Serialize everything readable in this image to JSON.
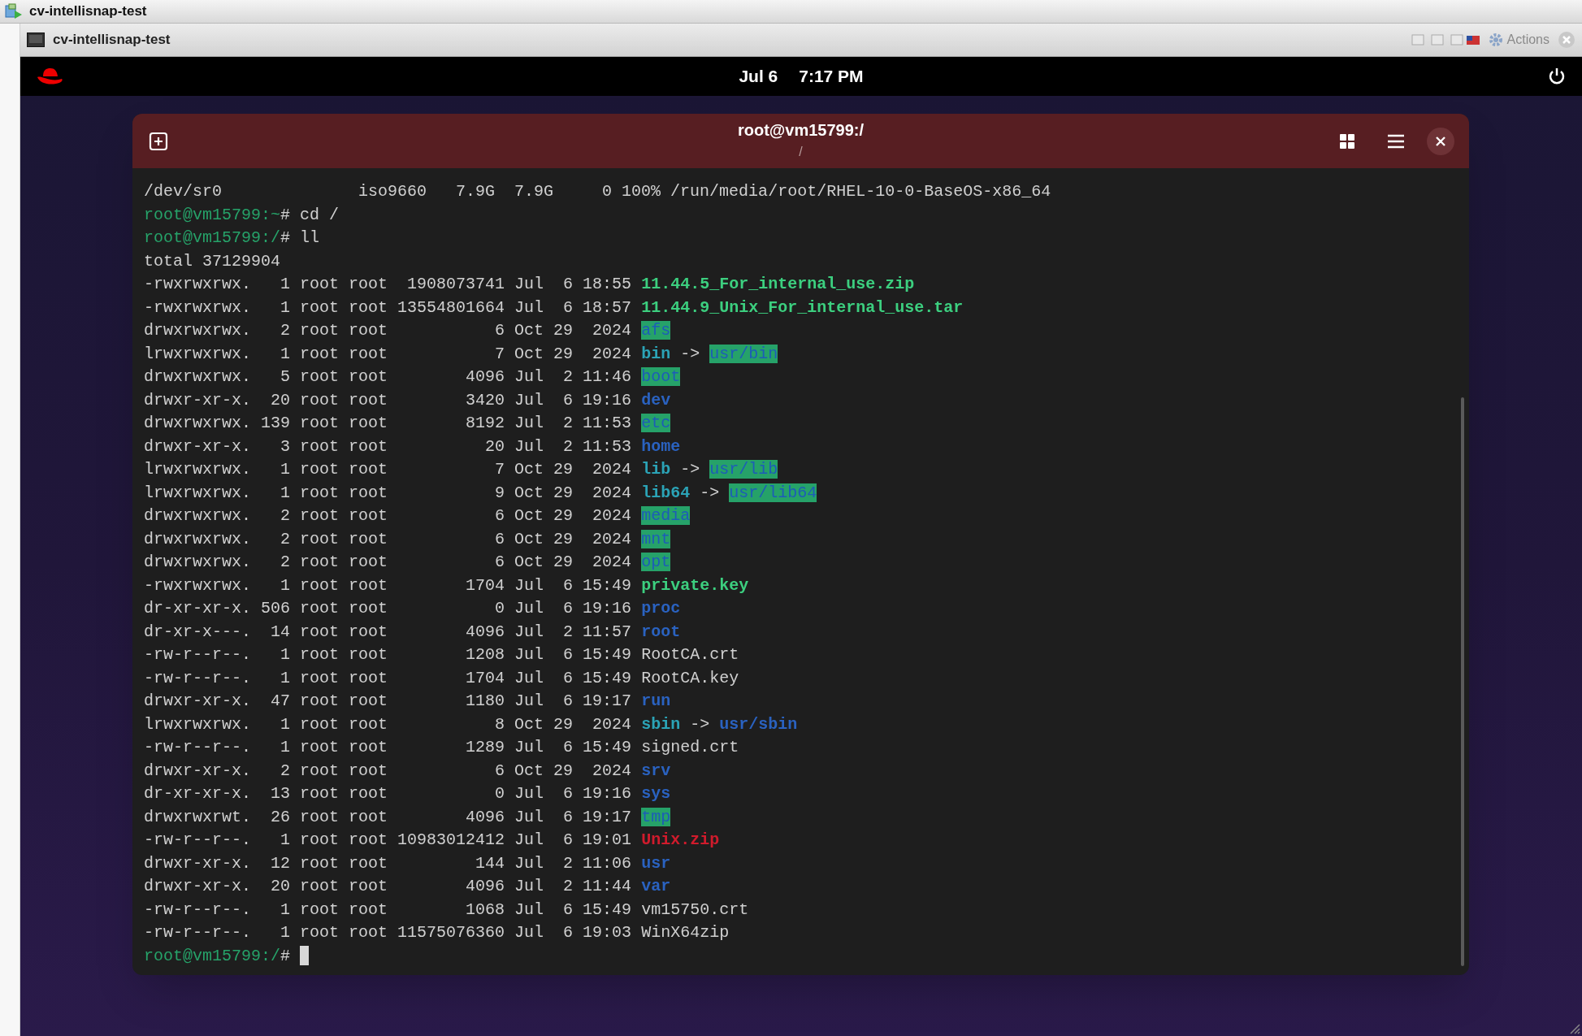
{
  "host_window": {
    "title": "cv-intellisnap-test"
  },
  "console_bar": {
    "title": "cv-intellisnap-test",
    "actions": "Actions"
  },
  "top_bar": {
    "date": "Jul 6",
    "time": "7:17 PM"
  },
  "terminal": {
    "title": "root@vm15799:/",
    "subtitle": "/",
    "lines": [
      {
        "kind": "output",
        "text": "/dev/sr0              iso9660   7.9G  7.9G     0 100% /run/media/root/RHEL-10-0-BaseOS-x86_64"
      },
      {
        "kind": "command",
        "prompt": "root@vm15799:~",
        "symbol": "#",
        "command": "cd /"
      },
      {
        "kind": "command",
        "prompt": "root@vm15799:/",
        "symbol": "#",
        "command": "ll"
      },
      {
        "kind": "output",
        "text": "total 37129904"
      },
      {
        "kind": "entry",
        "meta": "-rwxrwxrwx.   1 root root  1908073741 Jul  6 18:55",
        "name": {
          "text": "11.44.5_For_internal_use.zip",
          "kind": "exec"
        }
      },
      {
        "kind": "entry",
        "meta": "-rwxrwxrwx.   1 root root 13554801664 Jul  6 18:57",
        "name": {
          "text": "11.44.9_Unix_For_internal_use.tar",
          "kind": "exec"
        }
      },
      {
        "kind": "entry",
        "meta": "drwxrwxrwx.   2 root root           6 Oct 29  2024",
        "name": {
          "text": "afs",
          "kind": "dir_hl"
        }
      },
      {
        "kind": "entry",
        "meta": "lrwxrwxrwx.   1 root root           7 Oct 29  2024",
        "name": {
          "text": "bin",
          "kind": "link"
        },
        "arrow": "->",
        "target": {
          "text": "usr/bin",
          "kind": "dir_hl"
        }
      },
      {
        "kind": "entry",
        "meta": "drwxrwxrwx.   5 root root        4096 Jul  2 11:46",
        "name": {
          "text": "boot",
          "kind": "dir_hl"
        }
      },
      {
        "kind": "entry",
        "meta": "drwxr-xr-x.  20 root root        3420 Jul  6 19:16",
        "name": {
          "text": "dev",
          "kind": "dir"
        }
      },
      {
        "kind": "entry",
        "meta": "drwxrwxrwx. 139 root root        8192 Jul  2 11:53",
        "name": {
          "text": "etc",
          "kind": "dir_hl"
        }
      },
      {
        "kind": "entry",
        "meta": "drwxr-xr-x.   3 root root          20 Jul  2 11:53",
        "name": {
          "text": "home",
          "kind": "dir"
        }
      },
      {
        "kind": "entry",
        "meta": "lrwxrwxrwx.   1 root root           7 Oct 29  2024",
        "name": {
          "text": "lib",
          "kind": "link"
        },
        "arrow": "->",
        "target": {
          "text": "usr/lib",
          "kind": "dir_hl"
        }
      },
      {
        "kind": "entry",
        "meta": "lrwxrwxrwx.   1 root root           9 Oct 29  2024",
        "name": {
          "text": "lib64",
          "kind": "link"
        },
        "arrow": "->",
        "target": {
          "text": "usr/lib64",
          "kind": "dir_hl"
        }
      },
      {
        "kind": "entry",
        "meta": "drwxrwxrwx.   2 root root           6 Oct 29  2024",
        "name": {
          "text": "media",
          "kind": "dir_hl"
        }
      },
      {
        "kind": "entry",
        "meta": "drwxrwxrwx.   2 root root           6 Oct 29  2024",
        "name": {
          "text": "mnt",
          "kind": "dir_hl"
        }
      },
      {
        "kind": "entry",
        "meta": "drwxrwxrwx.   2 root root           6 Oct 29  2024",
        "name": {
          "text": "opt",
          "kind": "dir_hl"
        }
      },
      {
        "kind": "entry",
        "meta": "-rwxrwxrwx.   1 root root        1704 Jul  6 15:49",
        "name": {
          "text": "private.key",
          "kind": "exec"
        }
      },
      {
        "kind": "entry",
        "meta": "dr-xr-xr-x. 506 root root           0 Jul  6 19:16",
        "name": {
          "text": "proc",
          "kind": "dir"
        }
      },
      {
        "kind": "entry",
        "meta": "dr-xr-x---.  14 root root        4096 Jul  2 11:57",
        "name": {
          "text": "root",
          "kind": "dir"
        }
      },
      {
        "kind": "entry",
        "meta": "-rw-r--r--.   1 root root        1208 Jul  6 15:49",
        "name": {
          "text": "RootCA.crt",
          "kind": "file"
        }
      },
      {
        "kind": "entry",
        "meta": "-rw-r--r--.   1 root root        1704 Jul  6 15:49",
        "name": {
          "text": "RootCA.key",
          "kind": "file"
        }
      },
      {
        "kind": "entry",
        "meta": "drwxr-xr-x.  47 root root        1180 Jul  6 19:17",
        "name": {
          "text": "run",
          "kind": "dir"
        }
      },
      {
        "kind": "entry",
        "meta": "lrwxrwxrwx.   1 root root           8 Oct 29  2024",
        "name": {
          "text": "sbin",
          "kind": "link"
        },
        "arrow": "->",
        "target": {
          "text": "usr/sbin",
          "kind": "dir"
        }
      },
      {
        "kind": "entry",
        "meta": "-rw-r--r--.   1 root root        1289 Jul  6 15:49",
        "name": {
          "text": "signed.crt",
          "kind": "file"
        }
      },
      {
        "kind": "entry",
        "meta": "drwxr-xr-x.   2 root root           6 Oct 29  2024",
        "name": {
          "text": "srv",
          "kind": "dir"
        }
      },
      {
        "kind": "entry",
        "meta": "dr-xr-xr-x.  13 root root           0 Jul  6 19:16",
        "name": {
          "text": "sys",
          "kind": "dir"
        }
      },
      {
        "kind": "entry",
        "meta": "drwxrwxrwt.  26 root root        4096 Jul  6 19:17",
        "name": {
          "text": "tmp",
          "kind": "dir_hl"
        }
      },
      {
        "kind": "entry",
        "meta": "-rw-r--r--.   1 root root 10983012412 Jul  6 19:01",
        "name": {
          "text": "Unix.zip",
          "kind": "archive"
        }
      },
      {
        "kind": "entry",
        "meta": "drwxr-xr-x.  12 root root         144 Jul  2 11:06",
        "name": {
          "text": "usr",
          "kind": "dir"
        }
      },
      {
        "kind": "entry",
        "meta": "drwxr-xr-x.  20 root root        4096 Jul  2 11:44",
        "name": {
          "text": "var",
          "kind": "dir"
        }
      },
      {
        "kind": "entry",
        "meta": "-rw-r--r--.   1 root root        1068 Jul  6 15:49",
        "name": {
          "text": "vm15750.crt",
          "kind": "file"
        }
      },
      {
        "kind": "entry",
        "meta": "-rw-r--r--.   1 root root 11575076360 Jul  6 19:03",
        "name": {
          "text": "WinX64zip",
          "kind": "file"
        }
      },
      {
        "kind": "command",
        "prompt": "root@vm15799:/",
        "symbol": "#",
        "cursor": true
      }
    ]
  }
}
